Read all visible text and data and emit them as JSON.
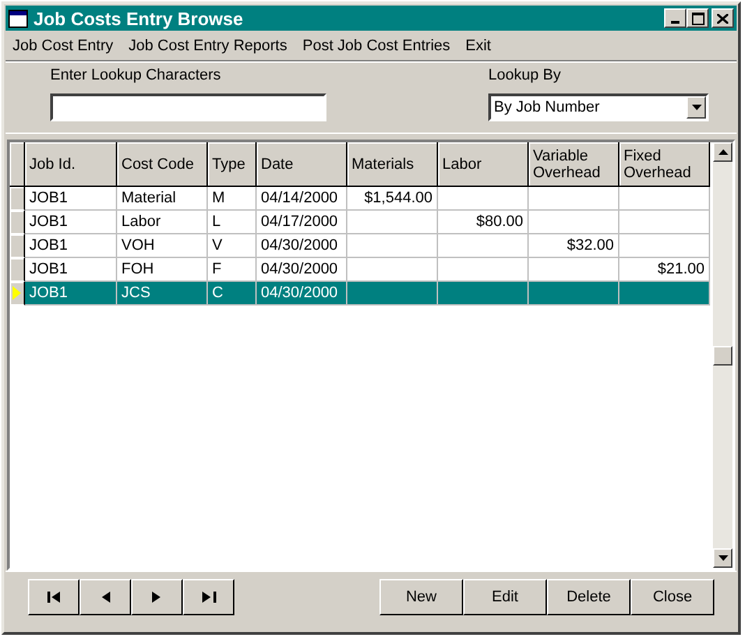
{
  "window": {
    "title": "Job Costs Entry Browse"
  },
  "menu": [
    "Job Cost Entry",
    "Job Cost Entry Reports",
    "Post Job Cost Entries",
    "Exit"
  ],
  "lookup": {
    "label": "Enter Lookup Characters",
    "value_label": "Lookup By",
    "lookup_by": "By Job Number"
  },
  "table": {
    "columns": [
      {
        "label": "Job Id."
      },
      {
        "label": "Cost Code"
      },
      {
        "label": "Type"
      },
      {
        "label": "Date"
      },
      {
        "label": "Materials"
      },
      {
        "label": "Labor"
      },
      {
        "label": "Variable Overhead"
      },
      {
        "label": "Fixed Overhead"
      }
    ],
    "rows": [
      {
        "selected": false,
        "cells": [
          "JOB1",
          "Material",
          "M",
          "04/14/2000",
          "$1,544.00",
          "",
          "",
          ""
        ]
      },
      {
        "selected": false,
        "cells": [
          "JOB1",
          "Labor",
          "L",
          "04/17/2000",
          "",
          "$80.00",
          "",
          ""
        ]
      },
      {
        "selected": false,
        "cells": [
          "JOB1",
          "VOH",
          "V",
          "04/30/2000",
          "",
          "",
          "$32.00",
          ""
        ]
      },
      {
        "selected": false,
        "cells": [
          "JOB1",
          "FOH",
          "F",
          "04/30/2000",
          "",
          "",
          "",
          "$21.00"
        ]
      },
      {
        "selected": true,
        "cells": [
          "JOB1",
          "JCS",
          "C",
          "04/30/2000",
          "",
          "",
          "",
          ""
        ]
      }
    ]
  },
  "buttons": [
    "New",
    "Edit",
    "Delete",
    "Close"
  ]
}
